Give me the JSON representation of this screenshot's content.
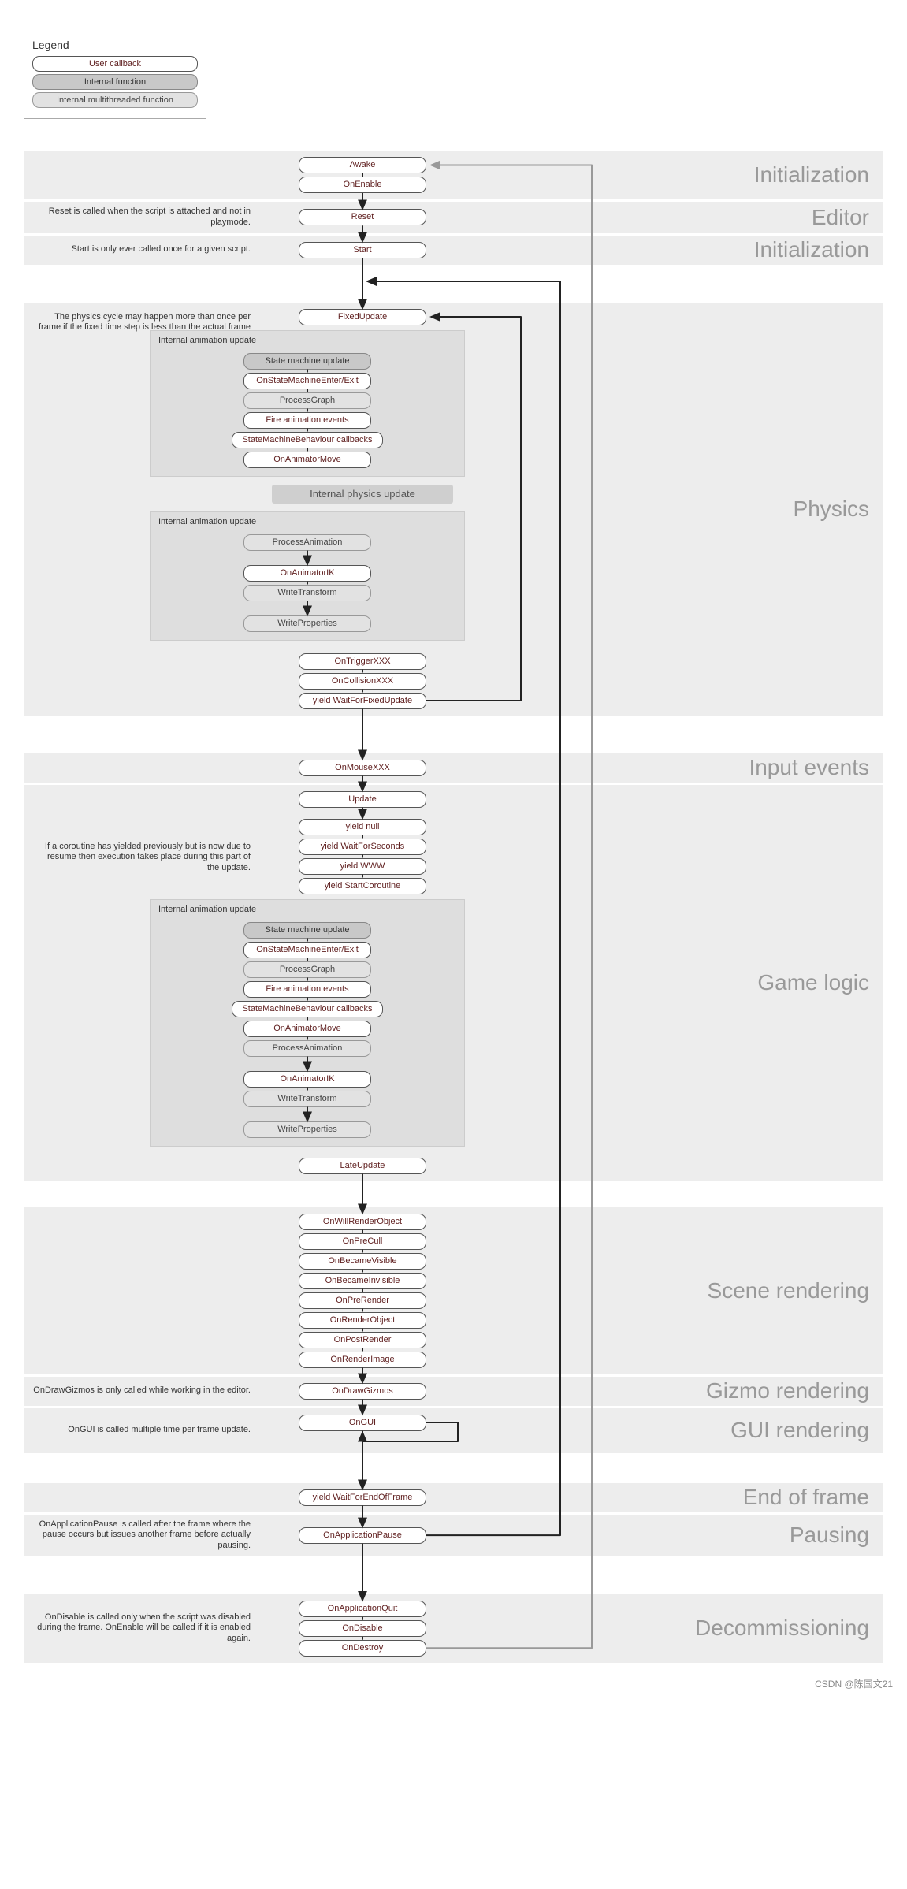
{
  "legend": {
    "title": "Legend",
    "user": "User callback",
    "internal": "Internal function",
    "multithread": "Internal multithreaded function"
  },
  "sections": {
    "init1": {
      "label": "Initialization",
      "nodes": [
        "Awake",
        "OnEnable"
      ]
    },
    "editor": {
      "label": "Editor",
      "note": "Reset is called when the script is attached and not in playmode.",
      "nodes": [
        "Reset"
      ]
    },
    "init2": {
      "label": "Initialization",
      "note": "Start is only ever called once for a given script.",
      "nodes": [
        "Start"
      ]
    },
    "physics": {
      "label": "Physics",
      "note": "The physics cycle may happen more than once per frame if the fixed time step is less than the actual frame update time.",
      "fixedUpdate": "FixedUpdate",
      "anim1": {
        "title": "Internal animation update",
        "items": [
          {
            "t": "internal",
            "v": "State machine update"
          },
          {
            "t": "user",
            "v": "OnStateMachineEnter/Exit"
          },
          {
            "t": "multithread",
            "v": "ProcessGraph"
          },
          {
            "t": "user",
            "v": "Fire animation events"
          },
          {
            "t": "user",
            "v": "StateMachineBehaviour callbacks"
          },
          {
            "t": "user",
            "v": "OnAnimatorMove"
          }
        ]
      },
      "physBar": "Internal physics update",
      "anim2": {
        "title": "Internal animation update",
        "items": [
          {
            "t": "multithread",
            "v": "ProcessAnimation"
          },
          {
            "t": "user",
            "v": "OnAnimatorIK"
          },
          {
            "t": "multithread",
            "v": "WriteTransform"
          },
          {
            "t": "multithread",
            "v": "WriteProperties"
          }
        ]
      },
      "after": [
        "OnTriggerXXX",
        "OnCollisionXXX",
        "yield WaitForFixedUpdate"
      ]
    },
    "input": {
      "label": "Input events",
      "nodes": [
        "OnMouseXXX"
      ]
    },
    "gamelogic": {
      "label": "Game logic",
      "update": "Update",
      "yieldNote": "If a coroutine has yielded previously but is now due to resume then execution takes place during this part of the update.",
      "yields": [
        "yield null",
        "yield WaitForSeconds",
        "yield WWW",
        "yield StartCoroutine"
      ],
      "anim": {
        "title": "Internal animation update",
        "items": [
          {
            "t": "internal",
            "v": "State machine update"
          },
          {
            "t": "user",
            "v": "OnStateMachineEnter/Exit"
          },
          {
            "t": "multithread",
            "v": "ProcessGraph"
          },
          {
            "t": "user",
            "v": "Fire animation events"
          },
          {
            "t": "user",
            "v": "StateMachineBehaviour callbacks"
          },
          {
            "t": "user",
            "v": "OnAnimatorMove"
          },
          {
            "t": "multithread",
            "v": "ProcessAnimation"
          },
          {
            "t": "user",
            "v": "OnAnimatorIK"
          },
          {
            "t": "multithread",
            "v": "WriteTransform"
          },
          {
            "t": "multithread",
            "v": "WriteProperties"
          }
        ]
      },
      "late": "LateUpdate"
    },
    "scenerender": {
      "label": "Scene rendering",
      "nodes": [
        "OnWillRenderObject",
        "OnPreCull",
        "OnBecameVisible",
        "OnBecameInvisible",
        "OnPreRender",
        "OnRenderObject",
        "OnPostRender",
        "OnRenderImage"
      ]
    },
    "gizmo": {
      "label": "Gizmo rendering",
      "note": "OnDrawGizmos is only called while working in the editor.",
      "nodes": [
        "OnDrawGizmos"
      ]
    },
    "gui": {
      "label": "GUI rendering",
      "note": "OnGUI is called multiple time per frame update.",
      "nodes": [
        "OnGUI"
      ]
    },
    "endframe": {
      "label": "End of frame",
      "nodes": [
        "yield WaitForEndOfFrame"
      ]
    },
    "pausing": {
      "label": "Pausing",
      "note": "OnApplicationPause is called after the frame where the pause occurs but issues another frame before actually pausing.",
      "nodes": [
        "OnApplicationPause"
      ]
    },
    "decom": {
      "label": "Decommissioning",
      "note": "OnDisable is called only when the script was disabled during the frame. OnEnable will be called if it is enabled again.",
      "nodes": [
        "OnApplicationQuit",
        "OnDisable",
        "OnDestroy"
      ]
    }
  },
  "footer": "CSDN @陈国文21"
}
